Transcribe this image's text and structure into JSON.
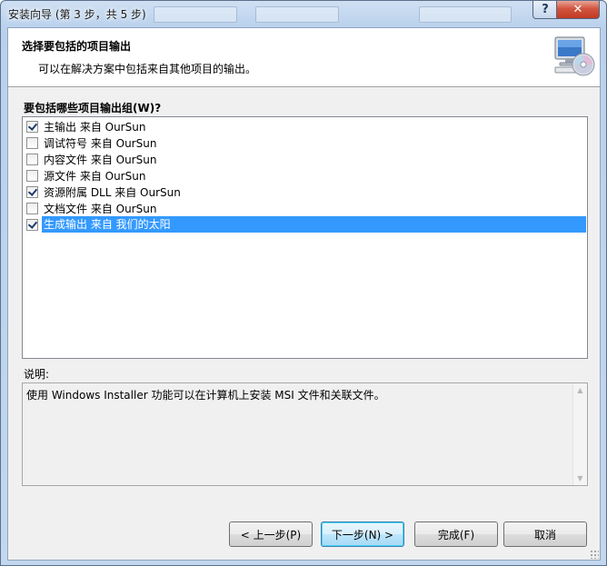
{
  "window": {
    "title": "安装向导 (第 3 步，共 5 步)",
    "help_button": "?",
    "close_button": "✕"
  },
  "header": {
    "title": "选择要包括的项目输出",
    "subtitle": "可以在解决方案中包括来自其他项目的输出。",
    "icon": "computer-cd-icon"
  },
  "output_groups": {
    "label": "要包括哪些项目输出组(W)?",
    "items": [
      {
        "label": "主输出 来自 OurSun",
        "checked": true,
        "selected": false
      },
      {
        "label": "调试符号 来自 OurSun",
        "checked": false,
        "selected": false
      },
      {
        "label": "内容文件 来自 OurSun",
        "checked": false,
        "selected": false
      },
      {
        "label": "源文件 来自 OurSun",
        "checked": false,
        "selected": false
      },
      {
        "label": "资源附属 DLL 来自 OurSun",
        "checked": true,
        "selected": false
      },
      {
        "label": "文档文件 来自 OurSun",
        "checked": false,
        "selected": false
      },
      {
        "label": "生成输出 来自 我们的太阳",
        "checked": true,
        "selected": true
      }
    ]
  },
  "description": {
    "label": "说明:",
    "text": "使用 Windows Installer 功能可以在计算机上安装 MSI 文件和关联文件。"
  },
  "buttons": {
    "back": "< 上一步(P)",
    "next": "下一步(N) >",
    "finish": "完成(F)",
    "cancel": "取消"
  },
  "colors": {
    "selection": "#3399ff",
    "dialog_bg": "#f0f0f0",
    "title_glass": "#b9d1ec"
  }
}
